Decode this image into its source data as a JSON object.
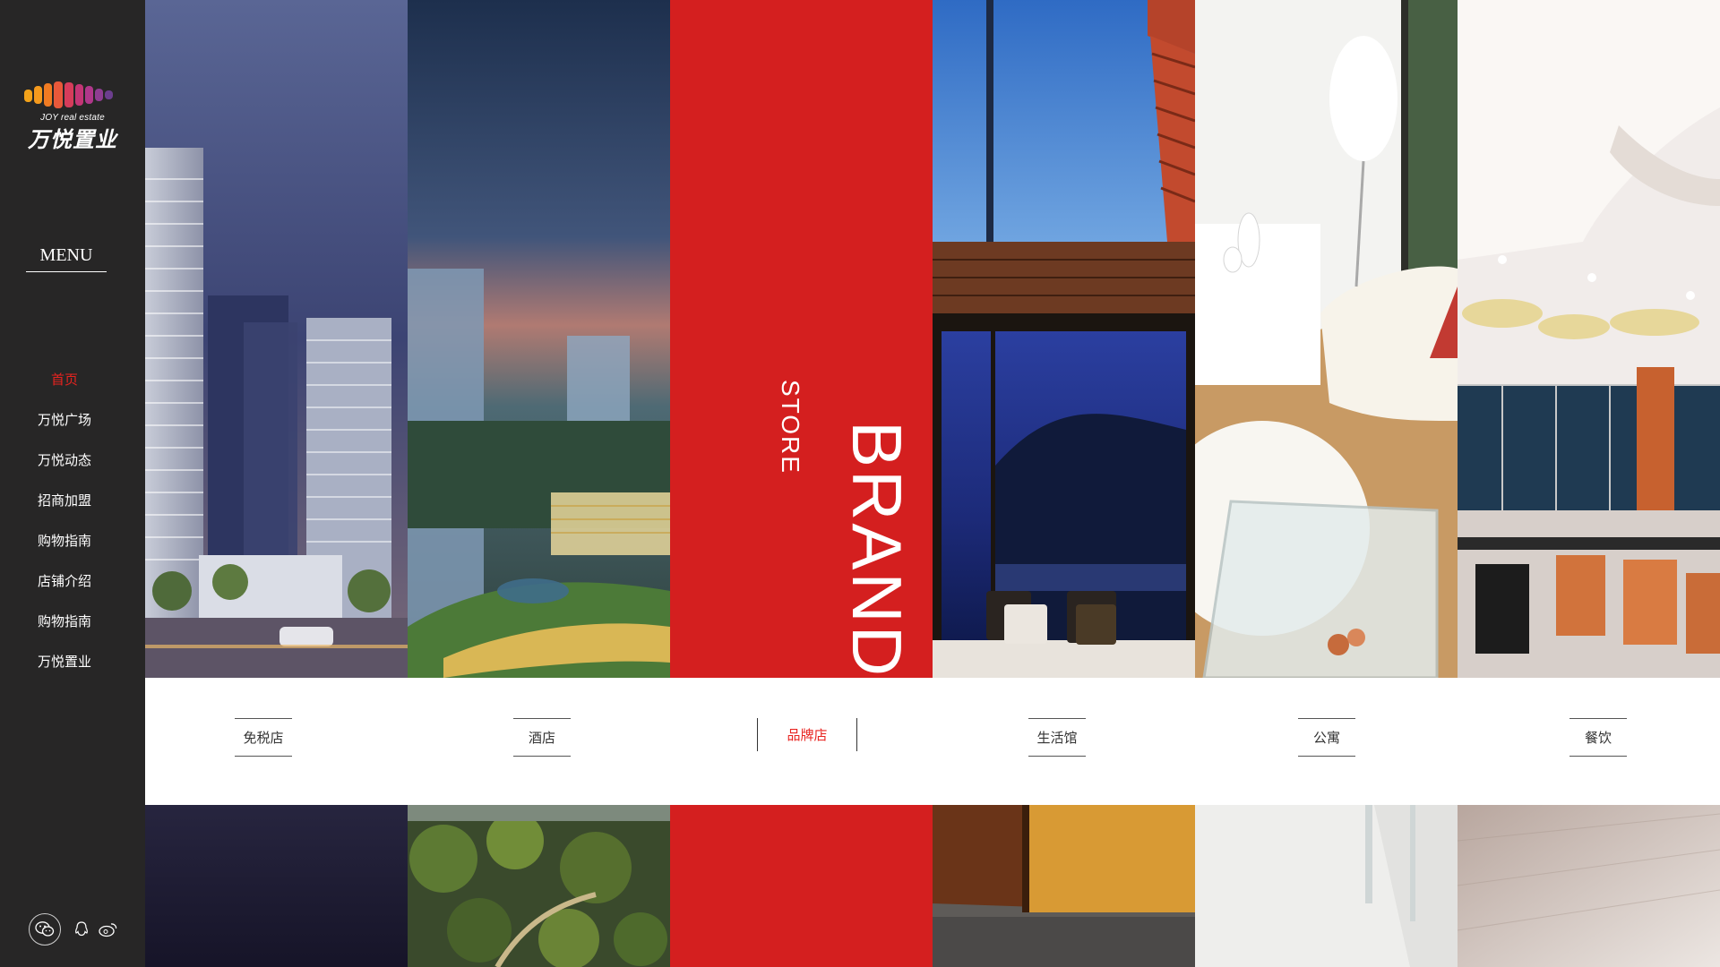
{
  "brand": {
    "logo_en": "JOY real estate",
    "logo_cn": "万悦置业"
  },
  "menu_title": "MENU",
  "nav": {
    "items": [
      {
        "label": "首页",
        "active": true
      },
      {
        "label": "万悦广场"
      },
      {
        "label": "万悦动态"
      },
      {
        "label": "招商加盟"
      },
      {
        "label": "购物指南"
      },
      {
        "label": "店铺介绍"
      },
      {
        "label": "购物指南"
      },
      {
        "label": "万悦置业"
      }
    ]
  },
  "categories": [
    {
      "label": "免税店"
    },
    {
      "label": "酒店"
    },
    {
      "label": "品牌店",
      "active": true
    },
    {
      "label": "生活馆"
    },
    {
      "label": "公寓"
    },
    {
      "label": "餐饮"
    }
  ],
  "brand_panel": {
    "line1": "STORE",
    "line2": "BRAND"
  },
  "social": [
    "wechat-icon",
    "qq-icon",
    "weibo-icon"
  ],
  "colors": {
    "sidebar_bg": "#272626",
    "accent": "#e8231f",
    "brand_red": "#d41f1f"
  }
}
